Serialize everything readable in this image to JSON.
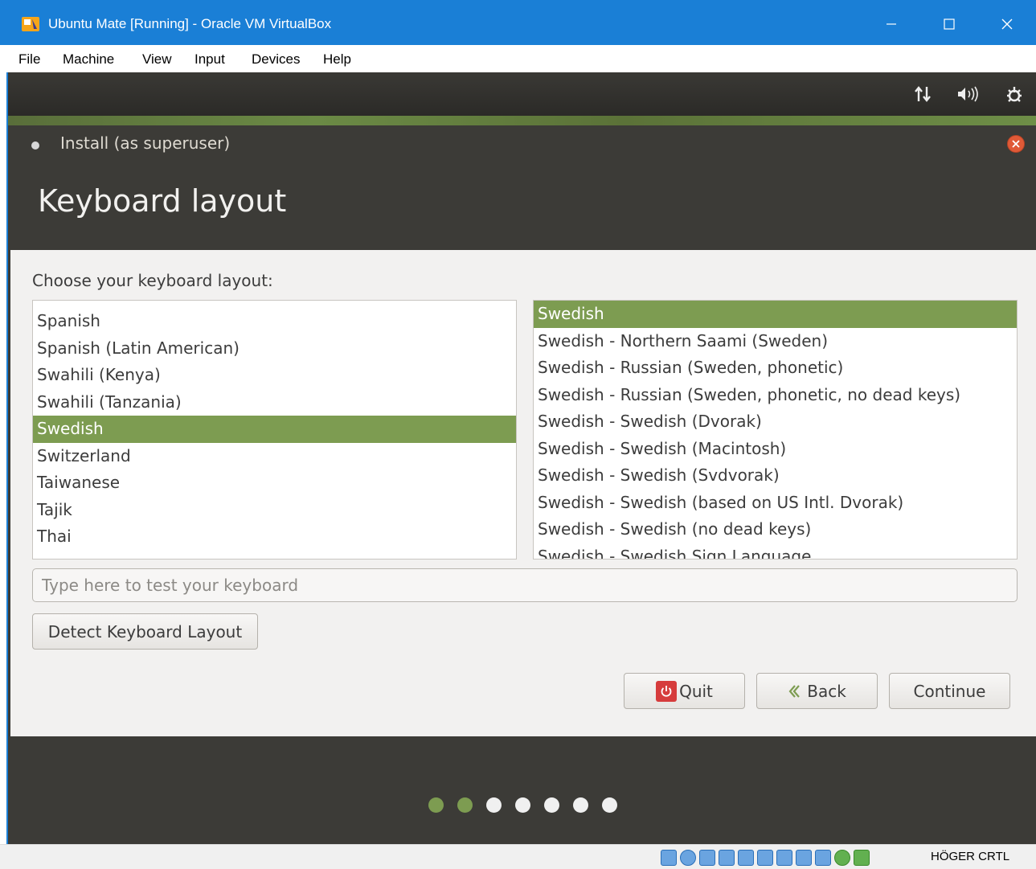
{
  "window": {
    "title": "Ubuntu Mate [Running] - Oracle VM VirtualBox",
    "icon": "virtualbox-icon"
  },
  "menubar": [
    "File",
    "Machine",
    "View",
    "Input",
    "Devices",
    "Help"
  ],
  "panel_icons": [
    "network-icon",
    "volume-icon",
    "settings-icon"
  ],
  "installer": {
    "window_title": "Install (as superuser)",
    "page_title": "Keyboard layout",
    "prompt": "Choose your keyboard layout:",
    "layouts": [
      "Spanish",
      "Spanish (Latin American)",
      "Swahili (Kenya)",
      "Swahili (Tanzania)",
      "Swedish",
      "Switzerland",
      "Taiwanese",
      "Tajik",
      "Thai"
    ],
    "selected_layout": "Swedish",
    "variants": [
      "Swedish",
      "Swedish - Northern Saami (Sweden)",
      "Swedish - Russian (Sweden, phonetic)",
      "Swedish - Russian (Sweden, phonetic, no dead keys)",
      "Swedish - Swedish (Dvorak)",
      "Swedish - Swedish (Macintosh)",
      "Swedish - Swedish (Svdvorak)",
      "Swedish - Swedish (based on US Intl. Dvorak)",
      "Swedish - Swedish (no dead keys)",
      "Swedish - Swedish Sign Language"
    ],
    "selected_variant": "Swedish",
    "test_placeholder": "Type here to test your keyboard",
    "test_value": "",
    "detect_label": "Detect Keyboard Layout",
    "quit_label": "Quit",
    "back_label": "Back",
    "continue_label": "Continue",
    "progress": {
      "steps_total": 7,
      "steps_done": 2
    }
  },
  "statusbar": {
    "host_key": "HÖGER CRTL"
  },
  "colors": {
    "accent": "#7d9c51",
    "titlebar": "#1a7fd6",
    "dark": "#3c3b37",
    "quit_red": "#d63c3c"
  }
}
